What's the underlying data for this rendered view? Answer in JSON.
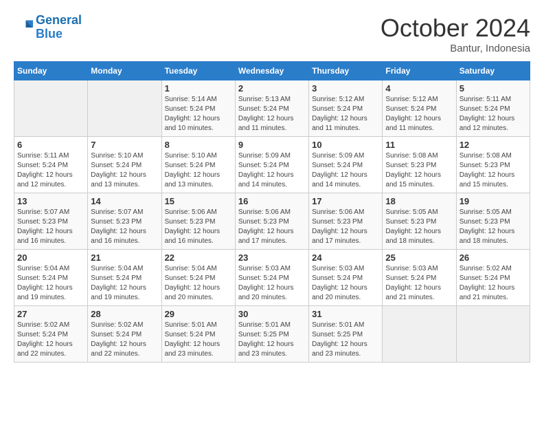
{
  "header": {
    "logo_line1": "General",
    "logo_line2": "Blue",
    "month_title": "October 2024",
    "location": "Bantur, Indonesia"
  },
  "weekdays": [
    "Sunday",
    "Monday",
    "Tuesday",
    "Wednesday",
    "Thursday",
    "Friday",
    "Saturday"
  ],
  "weeks": [
    [
      {
        "day": "",
        "info": ""
      },
      {
        "day": "",
        "info": ""
      },
      {
        "day": "1",
        "info": "Sunrise: 5:14 AM\nSunset: 5:24 PM\nDaylight: 12 hours and 10 minutes."
      },
      {
        "day": "2",
        "info": "Sunrise: 5:13 AM\nSunset: 5:24 PM\nDaylight: 12 hours and 11 minutes."
      },
      {
        "day": "3",
        "info": "Sunrise: 5:12 AM\nSunset: 5:24 PM\nDaylight: 12 hours and 11 minutes."
      },
      {
        "day": "4",
        "info": "Sunrise: 5:12 AM\nSunset: 5:24 PM\nDaylight: 12 hours and 11 minutes."
      },
      {
        "day": "5",
        "info": "Sunrise: 5:11 AM\nSunset: 5:24 PM\nDaylight: 12 hours and 12 minutes."
      }
    ],
    [
      {
        "day": "6",
        "info": "Sunrise: 5:11 AM\nSunset: 5:24 PM\nDaylight: 12 hours and 12 minutes."
      },
      {
        "day": "7",
        "info": "Sunrise: 5:10 AM\nSunset: 5:24 PM\nDaylight: 12 hours and 13 minutes."
      },
      {
        "day": "8",
        "info": "Sunrise: 5:10 AM\nSunset: 5:24 PM\nDaylight: 12 hours and 13 minutes."
      },
      {
        "day": "9",
        "info": "Sunrise: 5:09 AM\nSunset: 5:24 PM\nDaylight: 12 hours and 14 minutes."
      },
      {
        "day": "10",
        "info": "Sunrise: 5:09 AM\nSunset: 5:24 PM\nDaylight: 12 hours and 14 minutes."
      },
      {
        "day": "11",
        "info": "Sunrise: 5:08 AM\nSunset: 5:23 PM\nDaylight: 12 hours and 15 minutes."
      },
      {
        "day": "12",
        "info": "Sunrise: 5:08 AM\nSunset: 5:23 PM\nDaylight: 12 hours and 15 minutes."
      }
    ],
    [
      {
        "day": "13",
        "info": "Sunrise: 5:07 AM\nSunset: 5:23 PM\nDaylight: 12 hours and 16 minutes."
      },
      {
        "day": "14",
        "info": "Sunrise: 5:07 AM\nSunset: 5:23 PM\nDaylight: 12 hours and 16 minutes."
      },
      {
        "day": "15",
        "info": "Sunrise: 5:06 AM\nSunset: 5:23 PM\nDaylight: 12 hours and 16 minutes."
      },
      {
        "day": "16",
        "info": "Sunrise: 5:06 AM\nSunset: 5:23 PM\nDaylight: 12 hours and 17 minutes."
      },
      {
        "day": "17",
        "info": "Sunrise: 5:06 AM\nSunset: 5:23 PM\nDaylight: 12 hours and 17 minutes."
      },
      {
        "day": "18",
        "info": "Sunrise: 5:05 AM\nSunset: 5:23 PM\nDaylight: 12 hours and 18 minutes."
      },
      {
        "day": "19",
        "info": "Sunrise: 5:05 AM\nSunset: 5:23 PM\nDaylight: 12 hours and 18 minutes."
      }
    ],
    [
      {
        "day": "20",
        "info": "Sunrise: 5:04 AM\nSunset: 5:24 PM\nDaylight: 12 hours and 19 minutes."
      },
      {
        "day": "21",
        "info": "Sunrise: 5:04 AM\nSunset: 5:24 PM\nDaylight: 12 hours and 19 minutes."
      },
      {
        "day": "22",
        "info": "Sunrise: 5:04 AM\nSunset: 5:24 PM\nDaylight: 12 hours and 20 minutes."
      },
      {
        "day": "23",
        "info": "Sunrise: 5:03 AM\nSunset: 5:24 PM\nDaylight: 12 hours and 20 minutes."
      },
      {
        "day": "24",
        "info": "Sunrise: 5:03 AM\nSunset: 5:24 PM\nDaylight: 12 hours and 20 minutes."
      },
      {
        "day": "25",
        "info": "Sunrise: 5:03 AM\nSunset: 5:24 PM\nDaylight: 12 hours and 21 minutes."
      },
      {
        "day": "26",
        "info": "Sunrise: 5:02 AM\nSunset: 5:24 PM\nDaylight: 12 hours and 21 minutes."
      }
    ],
    [
      {
        "day": "27",
        "info": "Sunrise: 5:02 AM\nSunset: 5:24 PM\nDaylight: 12 hours and 22 minutes."
      },
      {
        "day": "28",
        "info": "Sunrise: 5:02 AM\nSunset: 5:24 PM\nDaylight: 12 hours and 22 minutes."
      },
      {
        "day": "29",
        "info": "Sunrise: 5:01 AM\nSunset: 5:24 PM\nDaylight: 12 hours and 23 minutes."
      },
      {
        "day": "30",
        "info": "Sunrise: 5:01 AM\nSunset: 5:25 PM\nDaylight: 12 hours and 23 minutes."
      },
      {
        "day": "31",
        "info": "Sunrise: 5:01 AM\nSunset: 5:25 PM\nDaylight: 12 hours and 23 minutes."
      },
      {
        "day": "",
        "info": ""
      },
      {
        "day": "",
        "info": ""
      }
    ]
  ]
}
